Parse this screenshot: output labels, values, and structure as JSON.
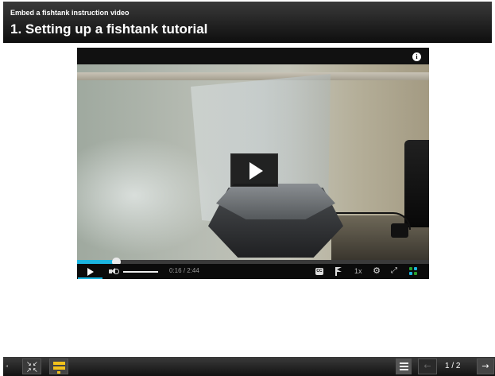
{
  "header": {
    "subtitle": "Embed a fishtank instruction video",
    "title": "1.  Setting up a fishtank tutorial"
  },
  "player": {
    "info_icon": "info-icon",
    "big_play_icon": "play-icon",
    "progress_fraction": 0.11,
    "time_current": "0:16",
    "time_total": "/ 2:44",
    "speed_label": "1x",
    "cc_label": "CC",
    "accent_color": "#1cb5e0"
  },
  "toolbar": {
    "page_indicator": "1 / 2",
    "accent_color": "#f2c21b"
  }
}
